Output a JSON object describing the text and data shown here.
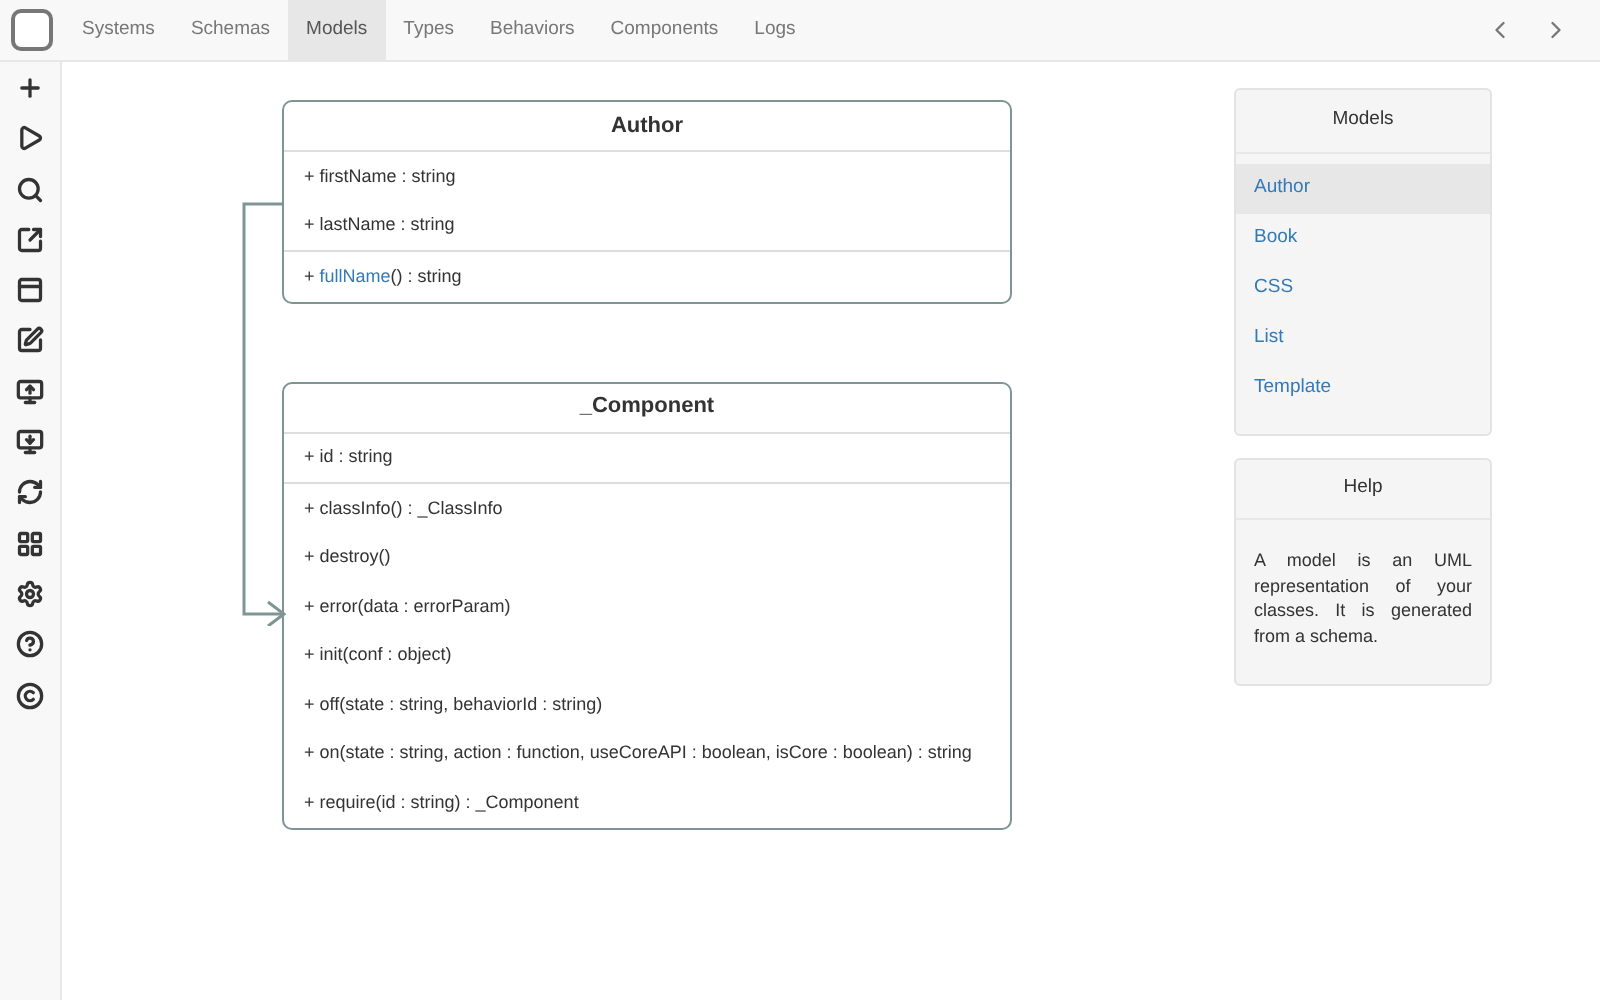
{
  "nav": {
    "tabs": [
      {
        "label": "Systems",
        "selected": false
      },
      {
        "label": "Schemas",
        "selected": false
      },
      {
        "label": "Models",
        "selected": true
      },
      {
        "label": "Types",
        "selected": false
      },
      {
        "label": "Behaviors",
        "selected": false
      },
      {
        "label": "Components",
        "selected": false
      },
      {
        "label": "Logs",
        "selected": false
      }
    ]
  },
  "classes": [
    {
      "name": "Author",
      "attributes": [
        {
          "text": "+ firstName : string"
        },
        {
          "text": "+ lastName : string"
        }
      ],
      "methods": [
        {
          "prefix": "+ ",
          "link": "fullName",
          "text": "() : string"
        }
      ]
    },
    {
      "name": "_Component",
      "attributes": [
        {
          "text": "+ id : string"
        }
      ],
      "methods": [
        {
          "text": "+ classInfo() : _ClassInfo"
        },
        {
          "text": "+ destroy()"
        },
        {
          "text": "+ error(data : errorParam)"
        },
        {
          "text": "+ init(conf : object)"
        },
        {
          "text": "+ off(state : string, behaviorId : string)"
        },
        {
          "text": "+ on(state : string, action : function, useCoreAPI : boolean, isCore : boolean) : string"
        },
        {
          "text": "+ require(id : string) : _Component"
        }
      ]
    }
  ],
  "models_panel": {
    "title": "Models",
    "items": [
      {
        "label": "Author",
        "selected": true
      },
      {
        "label": "Book",
        "selected": false
      },
      {
        "label": "CSS",
        "selected": false
      },
      {
        "label": "List",
        "selected": false
      },
      {
        "label": "Template",
        "selected": false
      }
    ]
  },
  "help_panel": {
    "title": "Help",
    "text": "A model is an UML representation of your classes. It is generated from a schema."
  }
}
